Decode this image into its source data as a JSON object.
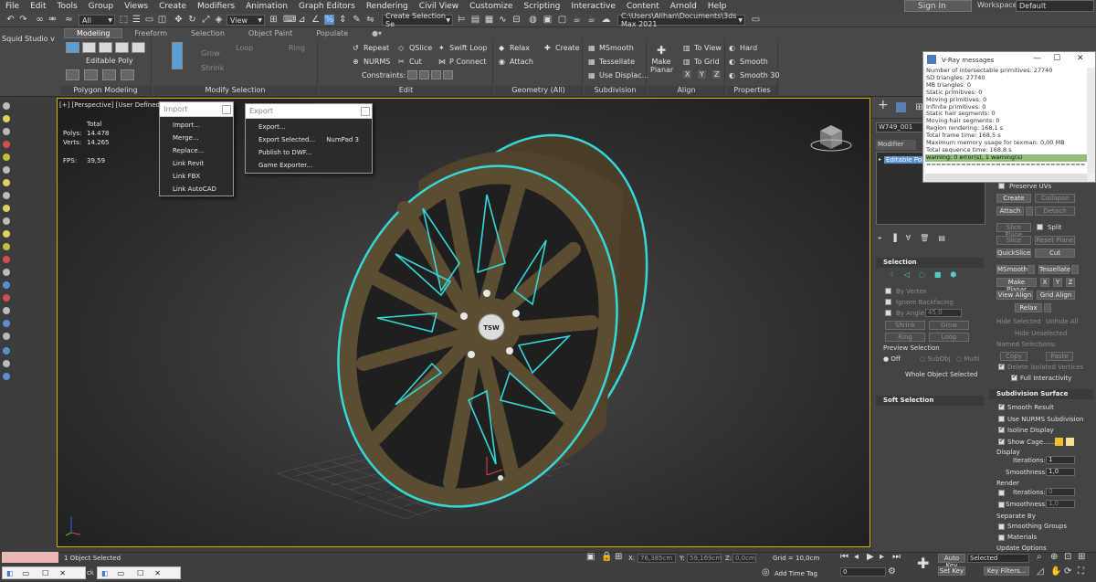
{
  "menubar": {
    "items": [
      "File",
      "Edit",
      "Tools",
      "Group",
      "Views",
      "Create",
      "Modifiers",
      "Animation",
      "Graph Editors",
      "Rendering",
      "Civil View",
      "Customize",
      "Scripting",
      "Interactive",
      "Content",
      "Arnold",
      "Help"
    ],
    "sign_in": "Sign In",
    "workspaces_label": "Workspaces:",
    "workspace_value": "Default"
  },
  "toolbar": {
    "filter": "All",
    "view": "View",
    "selection_set": "Create Selection Se",
    "path": "C:\\Users\\Alihan\\Documents\\3ds Max 2021"
  },
  "left_title": "Squid Studio v",
  "ribbon": {
    "tabs": [
      "Modeling",
      "Freeform",
      "Selection",
      "Object Paint",
      "Populate"
    ],
    "object_type": "Editable Poly",
    "groups": {
      "polygon_modeling": "Polygon Modeling",
      "modify_selection": "Modify Selection",
      "edit": "Edit",
      "geometry_all": "Geometry (All)",
      "subdivision": "Subdivision",
      "align": "Align",
      "properties": "Properties"
    },
    "modify": {
      "loop": "Loop",
      "ring": "Ring",
      "grow": "Grow",
      "shrink": "Shrink"
    },
    "edit": {
      "repeat": "Repeat",
      "qslice": "QSlice",
      "swift_loop": "Swift Loop",
      "nurms": "NURMS",
      "cut": "Cut",
      "p_connect": "P Connect",
      "constraints": "Constraints:"
    },
    "geometry": {
      "relax": "Relax",
      "create": "Create",
      "attach": "Attach"
    },
    "subdivision": {
      "msmooth": "MSmooth",
      "tessellate": "Tessellate",
      "use_displace": "Use Displac..."
    },
    "align": {
      "make_planar": "Make Planar",
      "to_view": "To View",
      "to_grid": "To Grid",
      "x": "X",
      "y": "Y",
      "z": "Z"
    },
    "properties": {
      "hard": "Hard",
      "smooth": "Smooth",
      "smooth30": "Smooth 30"
    }
  },
  "viewport": {
    "label": "[+] [Perspective] [User Defined] [D",
    "stats": {
      "total_label": "Total",
      "polys_label": "Polys:",
      "polys_value": "14.478",
      "verts_label": "Verts:",
      "verts_value": "14.265",
      "fps_label": "FPS:",
      "fps_value": "39,59"
    },
    "hub_logo": "TSW"
  },
  "import_menu": {
    "title": "Import",
    "items": [
      "Import...",
      "Merge...",
      "Replace...",
      "Link Revit",
      "Link FBX",
      "Link AutoCAD"
    ]
  },
  "export_menu": {
    "title": "Export",
    "items": [
      {
        "label": "Export...",
        "shortcut": ""
      },
      {
        "label": "Export Selected...",
        "shortcut": "NumPad 3"
      },
      {
        "label": "Publish to DWF...",
        "shortcut": ""
      },
      {
        "label": "Game Exporter...",
        "shortcut": ""
      }
    ]
  },
  "vray": {
    "title": "V-Ray messages",
    "lines": [
      "Number of intersectable primitives: 27740",
      "SD triangles: 27740",
      "MB triangles: 0",
      "Static primitives: 0",
      "Moving primitives: 0",
      "Infinite primitives: 0",
      "Static hair segments: 0",
      "Moving hair segments: 0",
      "Region rendering: 168,1 s",
      "Total frame time: 168,5 s",
      "Maximum memory usage for texman: 0,00 MB",
      "Total sequence time: 168,8 s",
      "warning: 0 error(s), 1 warning(s)",
      "================================"
    ]
  },
  "command_panel": {
    "object_name": "W749_001",
    "modifier_list": "Modifier List",
    "stack_item": "Editable Poly",
    "selection": {
      "title": "Selection",
      "by_vertex": "By Vertex",
      "ignore_backfacing": "Ignore Backfacing",
      "by_angle": "By Angle:",
      "by_angle_value": "45,0",
      "shrink": "Shrink",
      "grow": "Grow",
      "ring": "Ring",
      "loop": "Loop",
      "preview_selection": "Preview Selection",
      "off": "Off",
      "subobj": "SubObj",
      "multi": "Multi",
      "whole_object": "Whole Object Selected"
    },
    "soft_selection": "Soft Selection",
    "edit_geometry": {
      "preserve_uvs": "Preserve UVs",
      "create": "Create",
      "collapse": "Collapse",
      "attach": "Attach",
      "detach": "Detach",
      "slice_plane": "Slice Plane",
      "split": "Split",
      "slice": "Slice",
      "reset_plane": "Reset Plane",
      "quickslice": "QuickSlice",
      "cut": "Cut",
      "msmooth": "MSmooth",
      "tessellate": "Tessellate",
      "make_planar": "Make Planar",
      "x": "X",
      "y": "Y",
      "z": "Z",
      "view_align": "View Align",
      "grid_align": "Grid Align",
      "relax": "Relax",
      "hide_selected": "Hide Selected",
      "unhide_all": "Unhide All",
      "hide_unselected": "Hide Unselected",
      "named_selections": "Named Selections:",
      "copy": "Copy",
      "paste": "Paste",
      "delete_isolated": "Delete Isolated Vertices",
      "full_interactivity": "Full Interactivity"
    },
    "subdivision_surface": {
      "title": "Subdivision Surface",
      "smooth_result": "Smooth Result",
      "use_nurms": "Use NURMS Subdivision",
      "isoline_display": "Isoline Display",
      "show_cage": "Show Cage......",
      "display": "Display",
      "iterations": "Iterations:",
      "iterations_value": "1",
      "smoothness": "Smoothness:",
      "smoothness_value": "1,0",
      "render": "Render",
      "r_iterations_value": "0",
      "r_smoothness_value": "1,0",
      "separate_by": "Separate By",
      "smoothing_groups": "Smoothing Groups",
      "materials": "Materials",
      "update_options": "Update Options"
    }
  },
  "statusbar": {
    "objects_selected": "1 Object Selected",
    "x_label": "X:",
    "x_value": "76,385cm",
    "y_label": "Y:",
    "y_value": "59,169cm",
    "z_label": "Z:",
    "z_value": "0,0cm",
    "grid": "Grid = 10,0cm",
    "add_time_tag": "Add Time Tag",
    "auto_key": "Auto Key",
    "set_key": "Set Key",
    "selected": "Selected",
    "key_filters": "Key Filters...",
    "frame": "0",
    "taskbar_fragment": "ck"
  },
  "colors": {
    "rim": "#5b4d32",
    "highlight": "#35d8d8",
    "viewport_border": "#d8b000",
    "vray_warning": "#8fc07a"
  }
}
